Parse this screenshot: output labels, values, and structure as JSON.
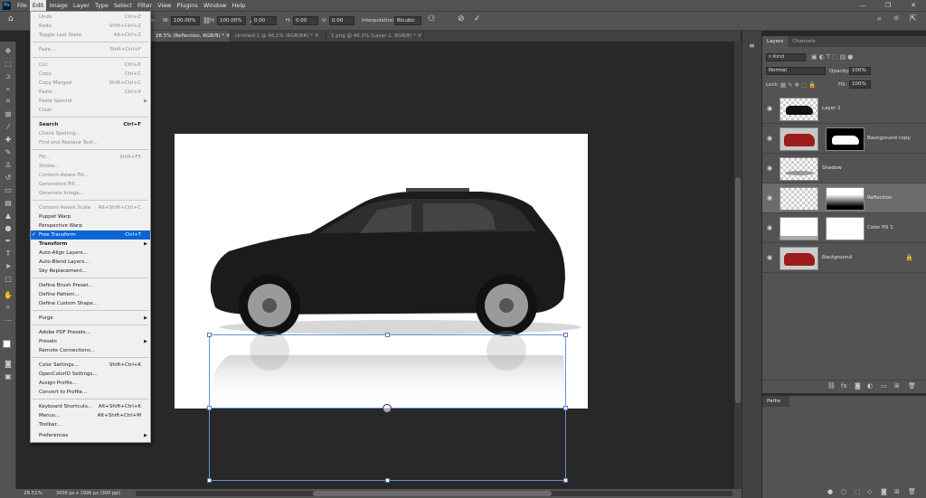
{
  "menubar": {
    "items": [
      "File",
      "Edit",
      "Image",
      "Layer",
      "Type",
      "Select",
      "Filter",
      "View",
      "Plugins",
      "Window",
      "Help"
    ]
  },
  "options": {
    "x_label": "p:",
    "w_label": "W:",
    "w_value": "100.00%",
    "h_label": "H:",
    "h_value": "100.00%",
    "angle_value": "0.00",
    "hskew_label": "H:",
    "hskew_value": "0.00",
    "vskew_label": "V:",
    "vskew_value": "0.00",
    "interp_label": "Interpolation:",
    "interp_value": "Bicubic"
  },
  "tabs": [
    {
      "label": "28.5% (Reflection, RGB/8) *"
    },
    {
      "label": "Untitled-1 @ 46.1% (RGB/8#) *"
    },
    {
      "label": "1.png @ 46.1% (Layer 1, RGB/8) *"
    }
  ],
  "edit_menu": {
    "items": [
      {
        "label": "Undo",
        "shortcut": "Ctrl+Z"
      },
      {
        "label": "Redo",
        "shortcut": "Shift+Ctrl+Z"
      },
      {
        "label": "Toggle Last State",
        "shortcut": "Alt+Ctrl+Z"
      },
      {
        "label": "Fade...",
        "shortcut": "Shift+Ctrl+F"
      },
      {
        "label": "Cut",
        "shortcut": "Ctrl+X"
      },
      {
        "label": "Copy",
        "shortcut": "Ctrl+C"
      },
      {
        "label": "Copy Merged",
        "shortcut": "Shift+Ctrl+C"
      },
      {
        "label": "Paste",
        "shortcut": "Ctrl+V"
      },
      {
        "label": "Paste Special",
        "shortcut": ""
      },
      {
        "label": "Clear",
        "shortcut": ""
      },
      {
        "label": "Search",
        "shortcut": "Ctrl+F"
      },
      {
        "label": "Check Spelling...",
        "shortcut": ""
      },
      {
        "label": "Find and Replace Text...",
        "shortcut": ""
      },
      {
        "label": "Fill...",
        "shortcut": "Shift+F5"
      },
      {
        "label": "Stroke...",
        "shortcut": ""
      },
      {
        "label": "Content-Aware Fill...",
        "shortcut": ""
      },
      {
        "label": "Generative Fill...",
        "shortcut": ""
      },
      {
        "label": "Generate Image...",
        "shortcut": ""
      },
      {
        "label": "Content-Aware Scale",
        "shortcut": "Alt+Shift+Ctrl+C"
      },
      {
        "label": "Puppet Warp",
        "shortcut": ""
      },
      {
        "label": "Perspective Warp",
        "shortcut": ""
      },
      {
        "label": "Free Transform",
        "shortcut": "Ctrl+T"
      },
      {
        "label": "Transform",
        "shortcut": ""
      },
      {
        "label": "Auto-Align Layers...",
        "shortcut": ""
      },
      {
        "label": "Auto-Blend Layers...",
        "shortcut": ""
      },
      {
        "label": "Sky Replacement...",
        "shortcut": ""
      },
      {
        "label": "Define Brush Preset...",
        "shortcut": ""
      },
      {
        "label": "Define Pattern...",
        "shortcut": ""
      },
      {
        "label": "Define Custom Shape...",
        "shortcut": ""
      },
      {
        "label": "Purge",
        "shortcut": ""
      },
      {
        "label": "Adobe PDF Presets...",
        "shortcut": ""
      },
      {
        "label": "Presets",
        "shortcut": ""
      },
      {
        "label": "Remote Connections...",
        "shortcut": ""
      },
      {
        "label": "Color Settings...",
        "shortcut": "Shift+Ctrl+K"
      },
      {
        "label": "OpenColorIO Settings...",
        "shortcut": ""
      },
      {
        "label": "Assign Profile...",
        "shortcut": ""
      },
      {
        "label": "Convert to Profile...",
        "shortcut": ""
      },
      {
        "label": "Keyboard Shortcuts...",
        "shortcut": "Alt+Shift+Ctrl+K"
      },
      {
        "label": "Menus...",
        "shortcut": "Alt+Shift+Ctrl+M"
      },
      {
        "label": "Toolbar...",
        "shortcut": ""
      },
      {
        "label": "Preferences",
        "shortcut": ""
      }
    ]
  },
  "layers_panel": {
    "tabs": [
      "Layers",
      "Channels"
    ],
    "filter_value": "Kind",
    "blend_mode": "Normal",
    "opacity_label": "Opacity:",
    "opacity_value": "100%",
    "lock_label": "Lock:",
    "fill_label": "Fill:",
    "fill_value": "100%",
    "layers": [
      {
        "name": "Layer 2"
      },
      {
        "name": "Background copy"
      },
      {
        "name": "Shadow"
      },
      {
        "name": "Reflection"
      },
      {
        "name": "Color Fill 1"
      },
      {
        "name": "Background"
      }
    ]
  },
  "paths_panel": {
    "title": "Paths"
  },
  "status": {
    "zoom": "28.51%",
    "doc_info": "3000 px x 1996 px (300 ppi)"
  }
}
